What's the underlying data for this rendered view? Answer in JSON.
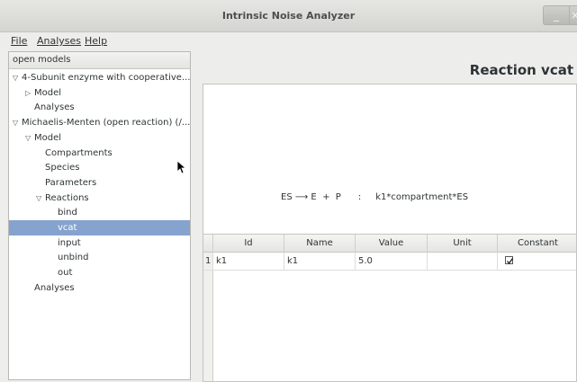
{
  "window": {
    "title": "Intrinsic Noise Analyzer",
    "minimize_glyph": "_",
    "close_glyph": "×"
  },
  "menubar": {
    "items": [
      {
        "label": "File",
        "underline": "F"
      },
      {
        "label": "Analyses",
        "underline": "A"
      },
      {
        "label": "Help",
        "underline": "H"
      }
    ]
  },
  "left_panel": {
    "header": "open models",
    "tree": [
      {
        "label": "4-Subunit enzyme with cooperative...",
        "indent": 0,
        "arrow": "down"
      },
      {
        "label": "Model",
        "indent": 1,
        "arrow": "right"
      },
      {
        "label": "Analyses",
        "indent": 1,
        "arrow": ""
      },
      {
        "label": "Michaelis-Menten (open reaction) (/...",
        "indent": 0,
        "arrow": "down"
      },
      {
        "label": "Model",
        "indent": 1,
        "arrow": "down"
      },
      {
        "label": "Compartments",
        "indent": 2,
        "arrow": ""
      },
      {
        "label": "Species",
        "indent": 2,
        "arrow": ""
      },
      {
        "label": "Parameters",
        "indent": 2,
        "arrow": ""
      },
      {
        "label": "Reactions",
        "indent": 2,
        "arrow": "down"
      },
      {
        "label": "bind",
        "indent": 3,
        "arrow": ""
      },
      {
        "label": "vcat",
        "indent": 3,
        "arrow": "",
        "selected": true
      },
      {
        "label": "input",
        "indent": 3,
        "arrow": ""
      },
      {
        "label": "unbind",
        "indent": 3,
        "arrow": ""
      },
      {
        "label": "out",
        "indent": 3,
        "arrow": ""
      },
      {
        "label": "Analyses",
        "indent": 1,
        "arrow": ""
      }
    ]
  },
  "reaction_view": {
    "title": "Reaction vcat",
    "equation": {
      "reactants": "ES",
      "arrow": "⟶",
      "products": "E  +  P",
      "separator": ":",
      "rate_law": "k1*compartment*ES"
    },
    "table": {
      "columns": [
        "Id",
        "Name",
        "Value",
        "Unit",
        "Constant"
      ],
      "rows": [
        {
          "index": "1",
          "id": "k1",
          "name": "k1",
          "value": "5.0",
          "unit": "",
          "constant": true
        }
      ]
    }
  }
}
